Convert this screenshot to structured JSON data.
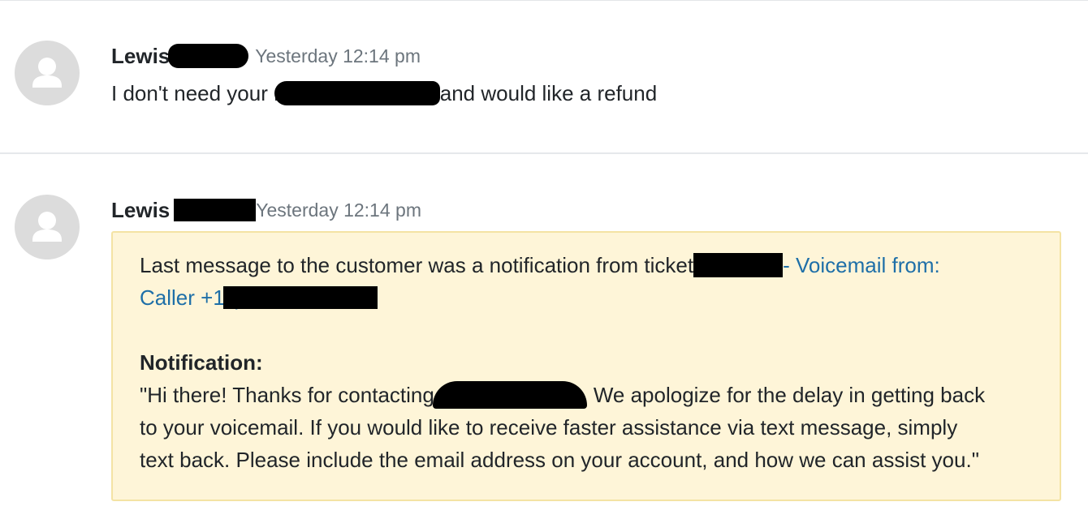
{
  "messages": [
    {
      "author": "Lewis",
      "timestamp": "Yesterday 12:14 pm",
      "text_before": "I don't need your r",
      "text_after": "and would like a refund"
    },
    {
      "author": "Lewis",
      "timestamp": "Yesterday 12:14 pm",
      "note": {
        "intro": "Last message to the customer was a notification from ticket",
        "link_part1": "- Voicemail from:",
        "link_part2": "Caller +1 (",
        "link_close": ")",
        "notification_label": "Notification:",
        "quote_start": "\"Hi there! Thanks for contacting",
        "quote_mid": "We apologize for the delay in getting back",
        "quote_line2": "to your voicemail. If you would like to receive faster assistance via text message, simply",
        "quote_line3": "text back. Please include the email address on your account, and how we can assist you.\""
      }
    }
  ],
  "colors": {
    "note_background": "#fef5d8",
    "note_border": "#f4e3a4",
    "link": "#1e6fa8",
    "timestamp": "#6c757d",
    "avatar": "#dcdcdc"
  }
}
